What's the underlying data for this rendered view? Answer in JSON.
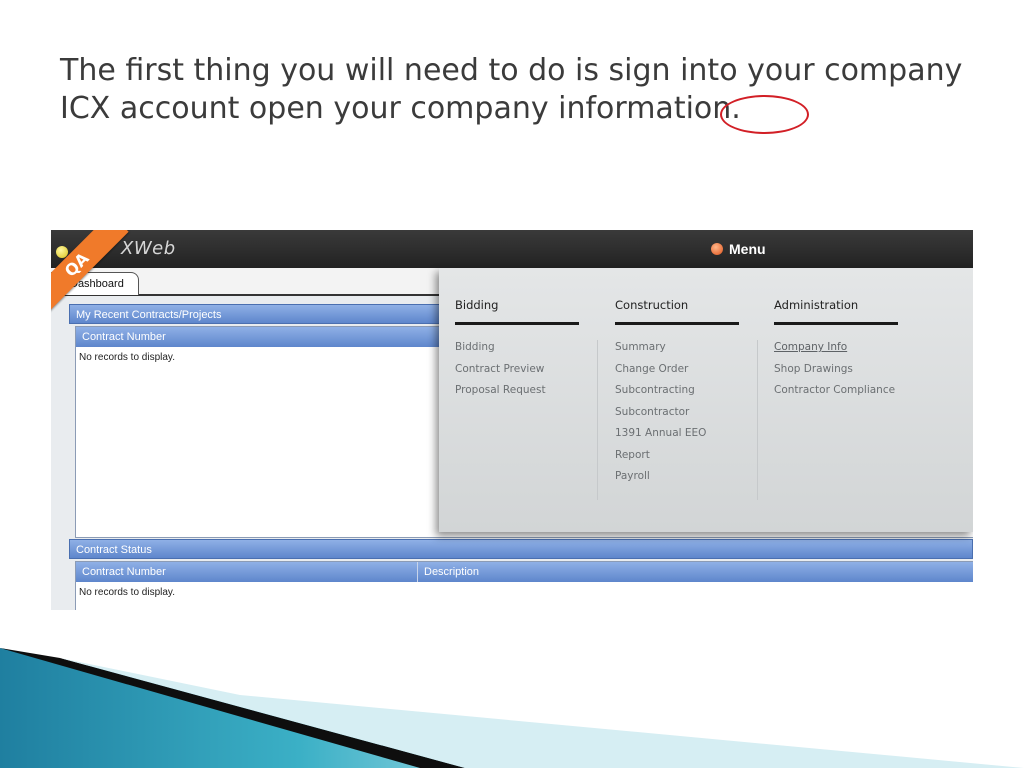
{
  "slide": {
    "title": "The first thing you will need to do is sign into your company ICX account open your company information."
  },
  "app": {
    "logo_text": "XWeb",
    "ribbon": "QA",
    "menu_label": "Menu",
    "tab": "Dashboard"
  },
  "panels": {
    "recent": {
      "title": "My Recent Contracts/Projects",
      "columns": [
        "Contract Number"
      ],
      "empty": "No records to display."
    },
    "status": {
      "title": "Contract Status",
      "columns": [
        "Contract Number",
        "Description"
      ],
      "empty": "No records to display."
    }
  },
  "mega_menu": {
    "columns": [
      {
        "title": "Bidding",
        "items": [
          "Bidding",
          "Contract Preview",
          "Proposal Request"
        ]
      },
      {
        "title": "Construction",
        "items": [
          "Summary",
          "Change Order",
          "Subcontracting",
          "Subcontractor",
          "1391 Annual EEO",
          "Report",
          "Payroll"
        ]
      },
      {
        "title": "Administration",
        "items": [
          "Company Info",
          "Shop Drawings",
          "Contractor Compliance"
        ]
      }
    ]
  },
  "colors": {
    "highlight": "#d21f26",
    "ribbon": "#f07a2a",
    "header_blue": "#5e86cc",
    "deco_teal": "#1f9bb3"
  }
}
